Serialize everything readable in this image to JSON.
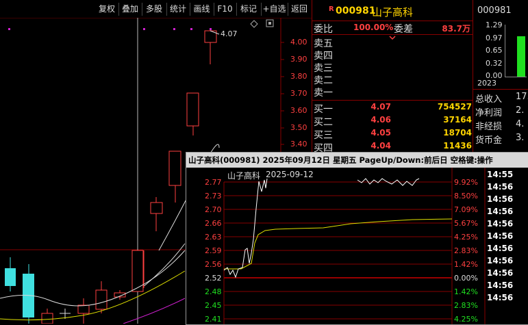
{
  "toolbar": {
    "buttons": [
      "复权",
      "叠加",
      "多股",
      "统计",
      "画线",
      "F10",
      "标记",
      "+自选",
      "返回"
    ]
  },
  "kchart": {
    "price_axis": [
      "4.00",
      "3.90",
      "3.80",
      "3.70",
      "3.60",
      "3.50",
      "3.40"
    ],
    "high_label": "4.07"
  },
  "quote": {
    "marker": "R",
    "code": "000981",
    "name": "山子高科",
    "weibi_label": "委比",
    "weibi_value": "100.00%",
    "weicha_label": "委差",
    "weicha_value": "83.7万",
    "asks": [
      "卖五",
      "卖四",
      "卖三",
      "卖二",
      "卖一"
    ],
    "bids": [
      {
        "label": "买一",
        "price": "4.07",
        "vol": "754527"
      },
      {
        "label": "买二",
        "price": "4.06",
        "vol": "37164"
      },
      {
        "label": "买三",
        "price": "4.05",
        "vol": "18704"
      },
      {
        "label": "买四",
        "price": "4.04",
        "vol": "11436"
      }
    ]
  },
  "fin": {
    "code": "000981",
    "axis": [
      "1.29",
      "0.97",
      "0.65",
      "0.32",
      "0.00"
    ],
    "year": "2023",
    "rows": [
      {
        "label": "总收入",
        "value": "17."
      },
      {
        "label": "净利润",
        "value": "2."
      },
      {
        "label": "非经损",
        "value": "4."
      },
      {
        "label": "货币金",
        "value": "3."
      }
    ],
    "bar_fraction": 0.78
  },
  "popup": {
    "title": "山子高科(000981)  2025年09月12日 星期五 PageUp/Down:前后日 空格键:操作",
    "name": "山子高科",
    "date": "2025-09-12",
    "prices": [
      "2.77",
      "2.73",
      "2.70",
      "2.66",
      "2.63",
      "2.59",
      "2.56",
      "2.52",
      "2.48",
      "2.45",
      "2.41"
    ],
    "pcts": [
      "9.92%",
      "8.50%",
      "7.09%",
      "5.67%",
      "4.25%",
      "2.83%",
      "1.42%",
      "0.00%",
      "1.42%",
      "2.83%",
      "4.25%"
    ],
    "times": [
      "14:55",
      "14:56",
      "14:56",
      "14:56",
      "14:56",
      "14:56",
      "14:56",
      "14:56",
      "14:56",
      "14:56",
      "14:56"
    ]
  }
}
